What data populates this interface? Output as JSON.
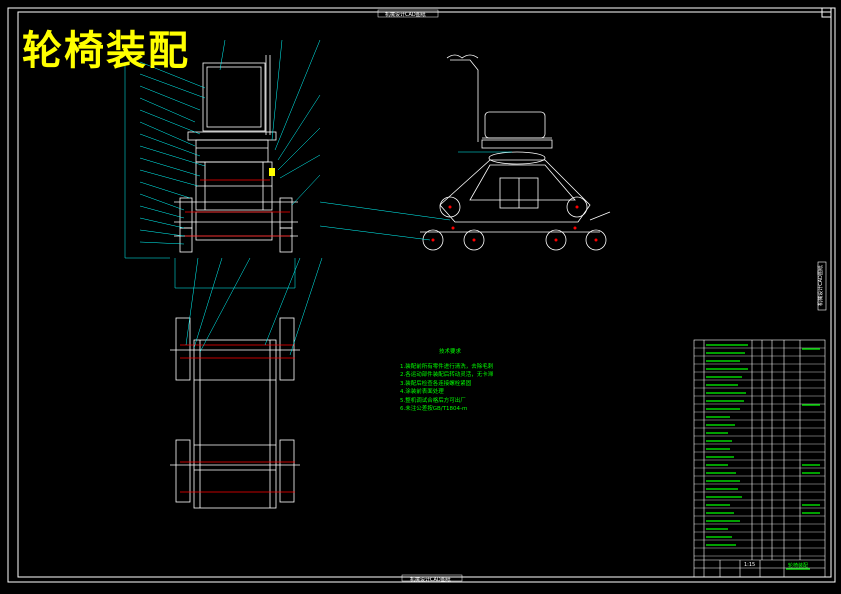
{
  "title": "轮椅装配",
  "top_label": "机械设计CAD图纸",
  "bottom_label": "机械设计CAD图纸",
  "side_label": "机械设计CAD图纸",
  "requirements": {
    "heading": "技术要求",
    "lines": [
      "1.装配前所有零件进行清洗，去除毛刺",
      "2.各运动部件装配后转动灵活，无卡滞",
      "3.装配后检查各连接螺栓紧固",
      "4.涂装前表面处理",
      "5.整机调试合格后方可出厂",
      "6.未注公差按GB/T1804-m"
    ]
  },
  "title_block": {
    "scale": "1:15",
    "name": "轮椅装配"
  },
  "colors": {
    "background": "#000000",
    "frame": "#ffffff",
    "leader": "#00ffff",
    "title": "#ffff00",
    "accent": "#ff0000",
    "text_green": "#00ff00"
  }
}
